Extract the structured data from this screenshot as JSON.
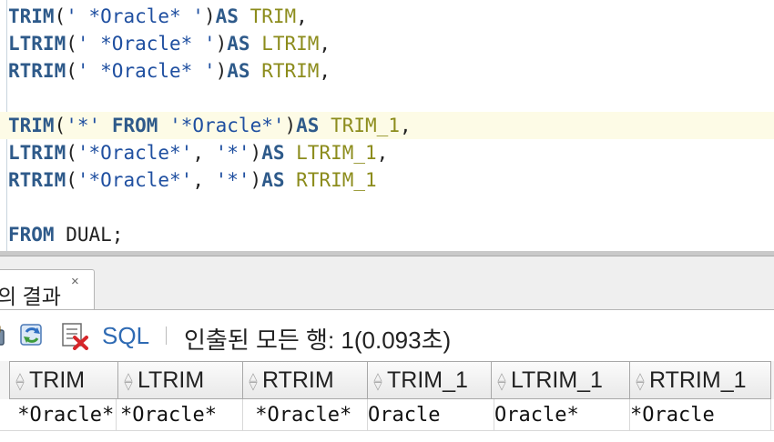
{
  "editor": {
    "lines": [
      [
        {
          "t": "kw",
          "v": "TRIM"
        },
        {
          "t": "plain",
          "v": "("
        },
        {
          "t": "str",
          "v": "' *Oracle* '"
        },
        {
          "t": "plain",
          "v": ")"
        },
        {
          "t": "kw",
          "v": "AS"
        },
        {
          "t": "plain",
          "v": " "
        },
        {
          "t": "alias",
          "v": "TRIM"
        },
        {
          "t": "plain",
          "v": ","
        }
      ],
      [
        {
          "t": "kw",
          "v": "LTRIM"
        },
        {
          "t": "plain",
          "v": "("
        },
        {
          "t": "str",
          "v": "' *Oracle* '"
        },
        {
          "t": "plain",
          "v": ")"
        },
        {
          "t": "kw",
          "v": "AS"
        },
        {
          "t": "plain",
          "v": " "
        },
        {
          "t": "alias",
          "v": "LTRIM"
        },
        {
          "t": "plain",
          "v": ","
        }
      ],
      [
        {
          "t": "kw",
          "v": "RTRIM"
        },
        {
          "t": "plain",
          "v": "("
        },
        {
          "t": "str",
          "v": "' *Oracle* '"
        },
        {
          "t": "plain",
          "v": ")"
        },
        {
          "t": "kw",
          "v": "AS"
        },
        {
          "t": "plain",
          "v": " "
        },
        {
          "t": "alias",
          "v": "RTRIM"
        },
        {
          "t": "plain",
          "v": ","
        }
      ],
      [],
      [
        {
          "t": "kw",
          "v": "TRIM"
        },
        {
          "t": "plain",
          "v": "("
        },
        {
          "t": "str",
          "v": "'*'"
        },
        {
          "t": "plain",
          "v": " "
        },
        {
          "t": "kw",
          "v": "FROM"
        },
        {
          "t": "plain",
          "v": " "
        },
        {
          "t": "str",
          "v": "'*Oracle*'"
        },
        {
          "t": "plain",
          "v": ")"
        },
        {
          "t": "kw",
          "v": "AS"
        },
        {
          "t": "plain",
          "v": " "
        },
        {
          "t": "alias",
          "v": "TRIM_1"
        },
        {
          "t": "plain",
          "v": ","
        }
      ],
      [
        {
          "t": "kw",
          "v": "LTRIM"
        },
        {
          "t": "plain",
          "v": "("
        },
        {
          "t": "str",
          "v": "'*Oracle*'"
        },
        {
          "t": "plain",
          "v": ", "
        },
        {
          "t": "str",
          "v": "'*'"
        },
        {
          "t": "plain",
          "v": ")"
        },
        {
          "t": "kw",
          "v": "AS"
        },
        {
          "t": "plain",
          "v": " "
        },
        {
          "t": "alias",
          "v": "LTRIM_1"
        },
        {
          "t": "plain",
          "v": ","
        }
      ],
      [
        {
          "t": "kw",
          "v": "RTRIM"
        },
        {
          "t": "plain",
          "v": "("
        },
        {
          "t": "str",
          "v": "'*Oracle*'"
        },
        {
          "t": "plain",
          "v": ", "
        },
        {
          "t": "str",
          "v": "'*'"
        },
        {
          "t": "plain",
          "v": ")"
        },
        {
          "t": "kw",
          "v": "AS"
        },
        {
          "t": "plain",
          "v": " "
        },
        {
          "t": "alias",
          "v": "RTRIM_1"
        }
      ],
      [],
      [
        {
          "t": "kw",
          "v": "FROM"
        },
        {
          "t": "plain",
          "v": " DUAL;"
        }
      ]
    ],
    "current_line": 4
  },
  "results": {
    "tab_label": "의 결과",
    "tab_close": "×",
    "toolbar": {
      "pin_icon": "pin-icon",
      "refresh_icon": "refresh-icon",
      "delete_icon": "delete-icon",
      "sql_label": "SQL",
      "status_text": "인출된 모든 행: 1(0.093초)"
    },
    "columns": [
      "TRIM",
      "LTRIM",
      "RTRIM",
      "TRIM_1",
      "LTRIM_1",
      "RTRIM_1"
    ],
    "rows": [
      [
        " *Oracle*",
        "*Oracle* ",
        " *Oracle*",
        "Oracle",
        "Oracle*",
        "*Oracle"
      ]
    ]
  },
  "colors": {
    "keyword": "#2e5a8a",
    "string": "#1f4fa0",
    "alias": "#8c8c1c",
    "current_line": "#fdfbe6"
  }
}
